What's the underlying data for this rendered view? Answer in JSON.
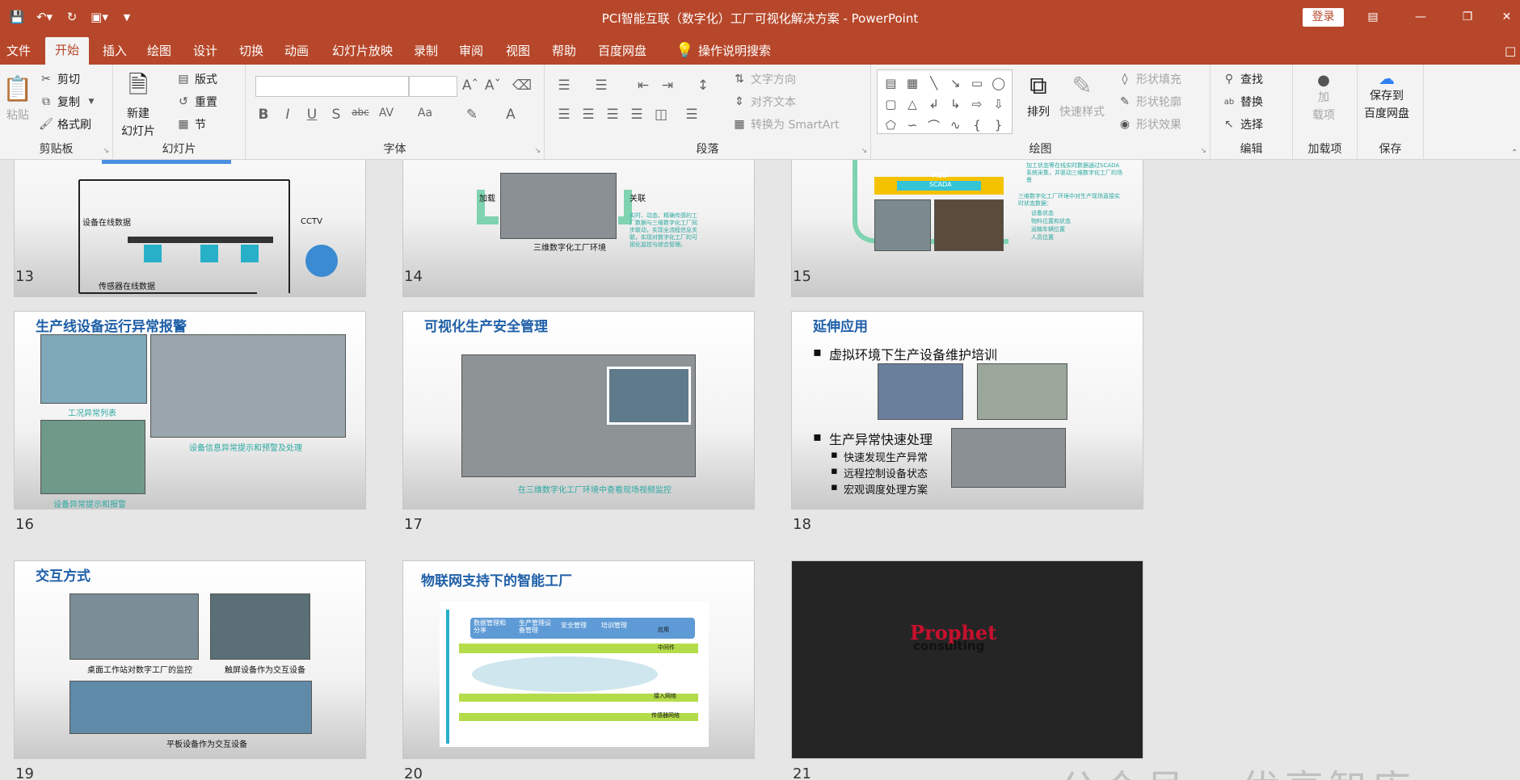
{
  "window": {
    "title": "PCI智能互联（数字化）工厂可视化解决方案 - PowerPoint",
    "login_label": "登录"
  },
  "qat": {
    "icons": [
      "save-icon",
      "undo-icon",
      "redo-icon",
      "present-icon",
      "customize-icon"
    ]
  },
  "tabs": [
    "文件",
    "开始",
    "插入",
    "绘图",
    "设计",
    "切换",
    "动画",
    "幻灯片放映",
    "录制",
    "审阅",
    "视图",
    "帮助",
    "百度网盘",
    "操作说明搜索"
  ],
  "ribbon": {
    "clipboard": {
      "paste": "粘贴",
      "cut": "剪切",
      "copy": "复制",
      "format_painter": "格式刷",
      "label": "剪贴板"
    },
    "slides": {
      "new_slide": "新建",
      "new_slide2": "幻灯片",
      "layout": "版式",
      "reset": "重置",
      "section": "节",
      "label": "幻灯片"
    },
    "font": {
      "label": "字体",
      "bold": "B",
      "italic": "I",
      "underline": "U",
      "shadow": "S",
      "strike": "abc",
      "spacing": "AV",
      "case": "Aa",
      "color": "A"
    },
    "paragraph": {
      "label": "段落",
      "text_direction": "文字方向",
      "align_text": "对齐文本",
      "smartart": "转换为 SmartArt"
    },
    "drawing": {
      "label": "绘图",
      "arrange": "排列",
      "quick_styles": "快速样式",
      "shape_fill": "形状填充",
      "shape_outline": "形状轮廓",
      "shape_effects": "形状效果"
    },
    "editing": {
      "label": "编辑",
      "find": "查找",
      "replace": "替换",
      "select": "选择"
    },
    "addins": {
      "label": "加载项",
      "btn1": "加",
      "btn2": "载项"
    },
    "save": {
      "label": "保存",
      "btn1": "保存到",
      "btn2": "百度网盘"
    }
  },
  "slides": {
    "s13": {
      "num": "13",
      "l1": "设备在线数据",
      "l2": "CCTV",
      "l3": "传感器在线数据"
    },
    "s14": {
      "num": "14",
      "l1": "加载",
      "l2": "关联",
      "cap": "三维数字化工厂环境",
      "note": "实时、动态、精确传感的工厂数据与三维数字化工厂同步联动，实现全流程信息关联，实现对数字化工厂的可视化监控与综合管理。"
    },
    "s15": {
      "num": "15",
      "mes": "MES",
      "scada": "SCADA",
      "t1": "加工状态等在线实时数据通过SCADA系统采集，并驱动三维数字化工厂的场景",
      "t2": "三维数字化工厂环境中对生产现场直接实时状态数据：",
      "i1": "设备状态",
      "i2": "物料位置和状态",
      "i3": "运输车辆位置",
      "i4": "人员位置"
    },
    "s16": {
      "num": "16",
      "title": "生产线设备运行异常报警",
      "c1": "工况异常列表",
      "c2": "设备信息异常提示和预警及处理",
      "c3": "设备异常提示和报警"
    },
    "s17": {
      "num": "17",
      "title": "可视化生产安全管理",
      "cap": "在三维数字化工厂环境中查看现场视频监控"
    },
    "s18": {
      "num": "18",
      "title": "延伸应用",
      "b1": "虚拟环境下生产设备维护培训",
      "b2": "生产异常快速处理",
      "s1": "快速发现生产异常",
      "s2": "远程控制设备状态",
      "s3": "宏观调度处理方案"
    },
    "s19": {
      "num": "19",
      "title": "交互方式",
      "l1": "桌面工作站对数字工厂的监控",
      "l2": "触屏设备作为交互设备",
      "l3": "平板设备作为交互设备"
    },
    "s20": {
      "num": "20",
      "title": "物联网支持下的智能工厂",
      "m1": "数据管理和分享",
      "m2": "生产管理设备管理",
      "m3": "安全管理",
      "m4": "培训管理",
      "m5": "应用",
      "m6": "中间件",
      "m7": "接入网络",
      "m8": "传感器网络"
    },
    "s21": {
      "num": "21",
      "logo1": "Prophet",
      "logo2": "consulting"
    }
  },
  "watermark": "公众号 · 优享智库"
}
